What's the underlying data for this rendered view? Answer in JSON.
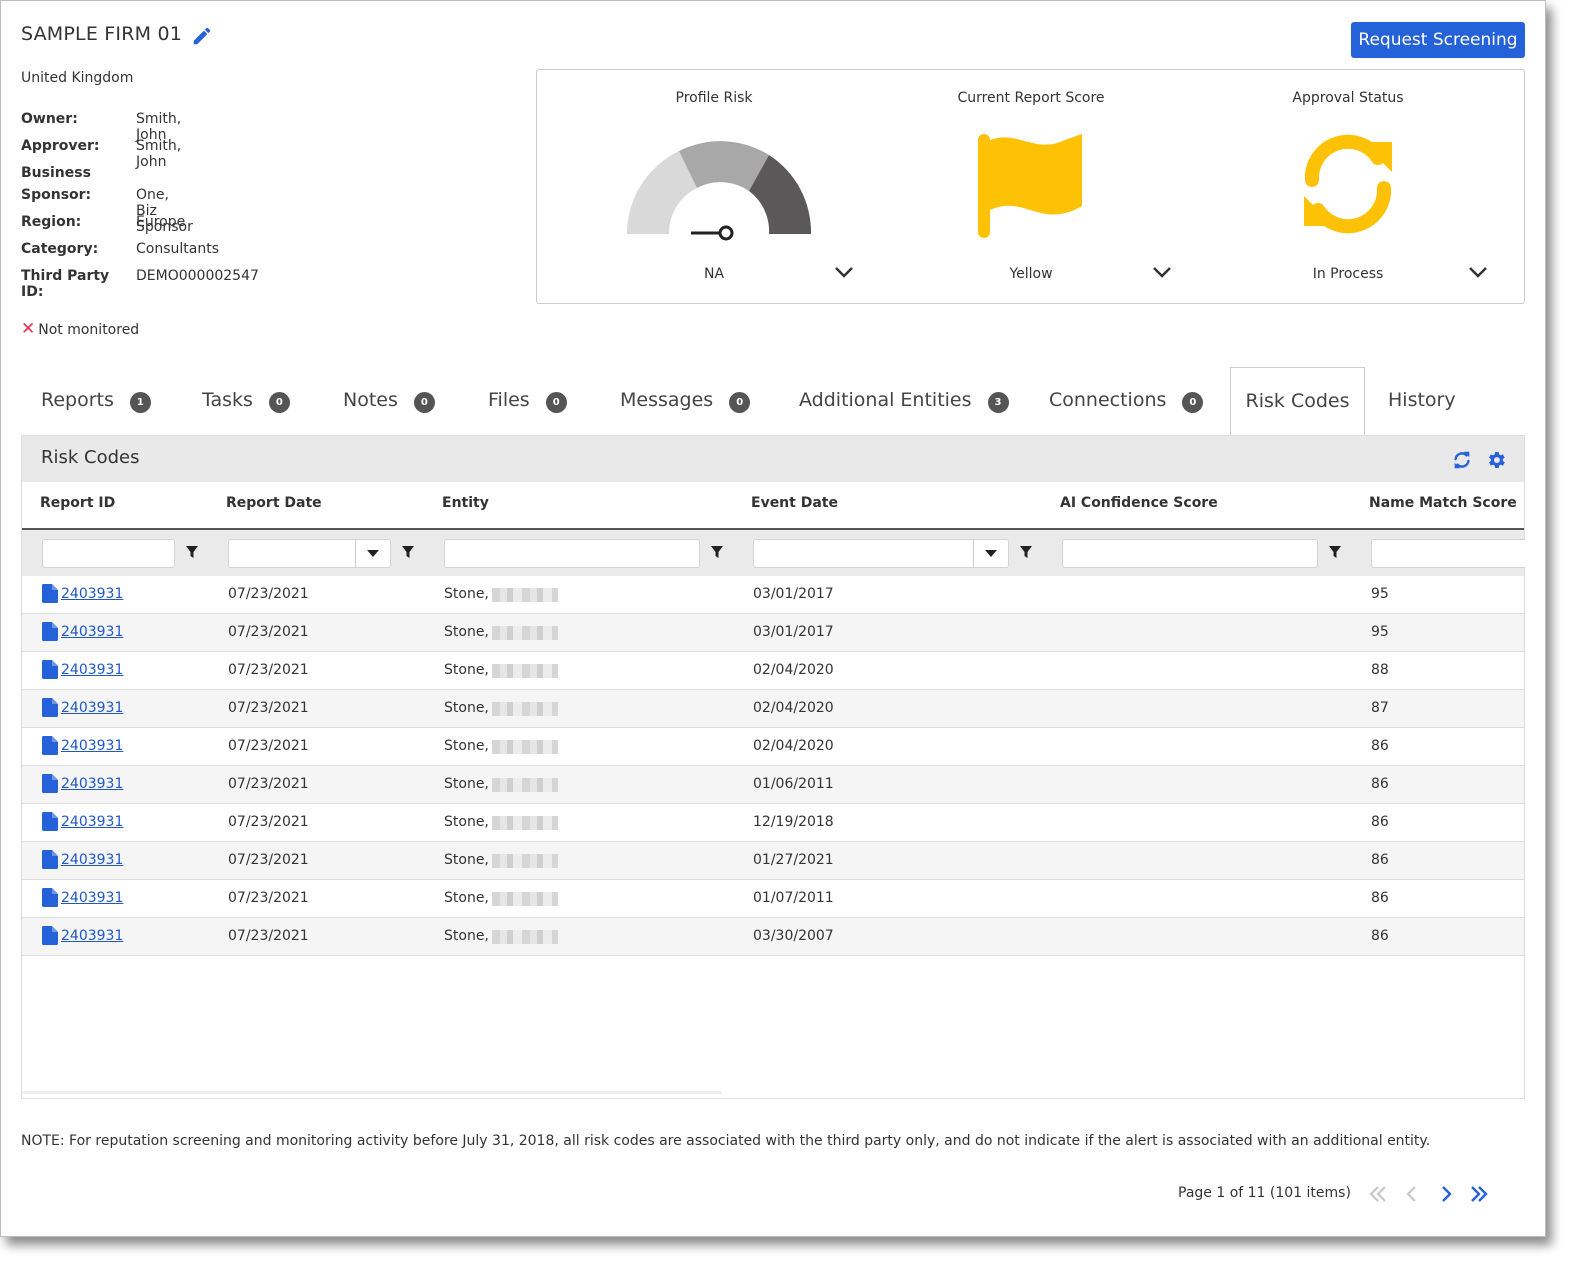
{
  "header": {
    "title": "SAMPLE FIRM 01",
    "country": "United Kingdom",
    "request_button": "Request Screening",
    "not_monitored": "Not monitored"
  },
  "info": [
    {
      "label": "Owner:",
      "value": "Smith, John"
    },
    {
      "label": "Approver:",
      "value": "Smith, John"
    },
    {
      "label": "Business Sponsor:",
      "label_line1": "Business",
      "label_line2": "Sponsor:",
      "value": "One, Biz Sponsor"
    },
    {
      "label": "Region:",
      "value": "Europe"
    },
    {
      "label": "Category:",
      "value": "Consultants"
    },
    {
      "label": "Third Party ID:",
      "value": "DEMO000002547"
    }
  ],
  "risk_cards": {
    "profile_risk": {
      "title": "Profile Risk",
      "value": "NA",
      "icon": "gauge-icon"
    },
    "report_score": {
      "title": "Current Report Score",
      "value": "Yellow",
      "icon": "flag-icon"
    },
    "approval": {
      "title": "Approval Status",
      "value": "In Process",
      "icon": "sync-icon"
    }
  },
  "tabs": [
    {
      "label": "Reports",
      "count": "1"
    },
    {
      "label": "Tasks",
      "count": "0"
    },
    {
      "label": "Notes",
      "count": "0"
    },
    {
      "label": "Files",
      "count": "0"
    },
    {
      "label": "Messages",
      "count": "0"
    },
    {
      "label": "Additional Entities",
      "count": "3"
    },
    {
      "label": "Connections",
      "count": "0"
    },
    {
      "label": "Risk Codes",
      "count": null,
      "active": true
    },
    {
      "label": "History",
      "count": null
    }
  ],
  "grid": {
    "title": "Risk Codes",
    "columns": [
      "Report ID",
      "Report Date",
      "Entity",
      "Event Date",
      "AI Confidence Score",
      "Name Match Score"
    ],
    "rows": [
      {
        "report_id": "2403931",
        "report_date": "07/23/2021",
        "entity": "Stone,",
        "event_date": "03/01/2017",
        "ai_score": "",
        "name_match": "95"
      },
      {
        "report_id": "2403931",
        "report_date": "07/23/2021",
        "entity": "Stone,",
        "event_date": "03/01/2017",
        "ai_score": "",
        "name_match": "95"
      },
      {
        "report_id": "2403931",
        "report_date": "07/23/2021",
        "entity": "Stone,",
        "event_date": "02/04/2020",
        "ai_score": "",
        "name_match": "88"
      },
      {
        "report_id": "2403931",
        "report_date": "07/23/2021",
        "entity": "Stone,",
        "event_date": "02/04/2020",
        "ai_score": "",
        "name_match": "87"
      },
      {
        "report_id": "2403931",
        "report_date": "07/23/2021",
        "entity": "Stone,",
        "event_date": "02/04/2020",
        "ai_score": "",
        "name_match": "86"
      },
      {
        "report_id": "2403931",
        "report_date": "07/23/2021",
        "entity": "Stone,",
        "event_date": "01/06/2011",
        "ai_score": "",
        "name_match": "86"
      },
      {
        "report_id": "2403931",
        "report_date": "07/23/2021",
        "entity": "Stone,",
        "event_date": "12/19/2018",
        "ai_score": "",
        "name_match": "86"
      },
      {
        "report_id": "2403931",
        "report_date": "07/23/2021",
        "entity": "Stone,",
        "event_date": "01/27/2021",
        "ai_score": "",
        "name_match": "86"
      },
      {
        "report_id": "2403931",
        "report_date": "07/23/2021",
        "entity": "Stone,",
        "event_date": "01/07/2011",
        "ai_score": "",
        "name_match": "86"
      },
      {
        "report_id": "2403931",
        "report_date": "07/23/2021",
        "entity": "Stone,",
        "event_date": "03/30/2007",
        "ai_score": "",
        "name_match": "86"
      }
    ]
  },
  "note": "NOTE: For reputation screening and monitoring activity before July 31, 2018, all risk codes are associated with the third party only, and do not indicate if the alert is associated with an additional entity.",
  "pager": {
    "text": "Page 1 of 11 (101 items)",
    "current_page": 1,
    "total_pages": 11,
    "total_items": 101
  },
  "colors": {
    "accent": "#2561d8",
    "flag": "#fdc106",
    "error": "#e0334f"
  }
}
